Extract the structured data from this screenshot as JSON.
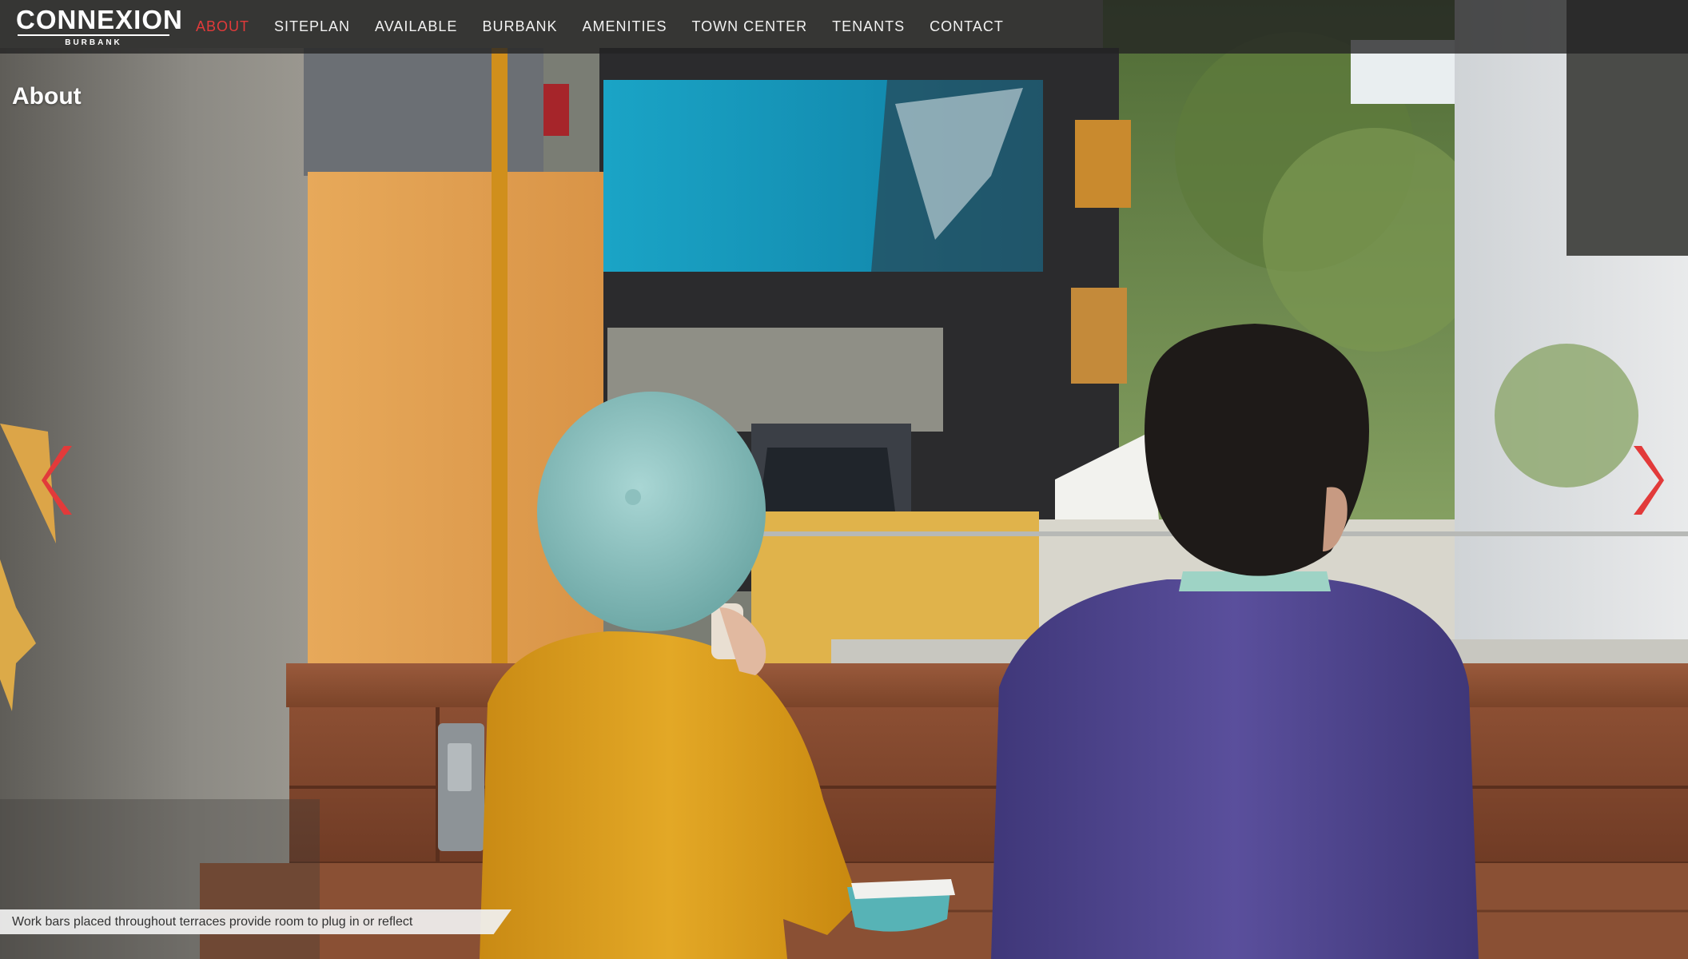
{
  "brand": {
    "name": "CONNEXION",
    "sub": "BURBANK"
  },
  "nav": {
    "items": [
      {
        "label": "ABOUT",
        "active": true
      },
      {
        "label": "SITEPLAN",
        "active": false
      },
      {
        "label": "AVAILABLE",
        "active": false
      },
      {
        "label": "BURBANK",
        "active": false
      },
      {
        "label": "AMENITIES",
        "active": false
      },
      {
        "label": "TOWN CENTER",
        "active": false
      },
      {
        "label": "TENANTS",
        "active": false
      },
      {
        "label": "CONTACT",
        "active": false
      }
    ]
  },
  "page": {
    "title": "About"
  },
  "slide": {
    "caption": "Work bars placed throughout terraces provide room to plug in or reflect"
  },
  "colors": {
    "accent": "#e23a3a",
    "nav_bg": "#232323"
  },
  "icons": {
    "prev": "chevron-left-icon",
    "next": "chevron-right-icon"
  }
}
